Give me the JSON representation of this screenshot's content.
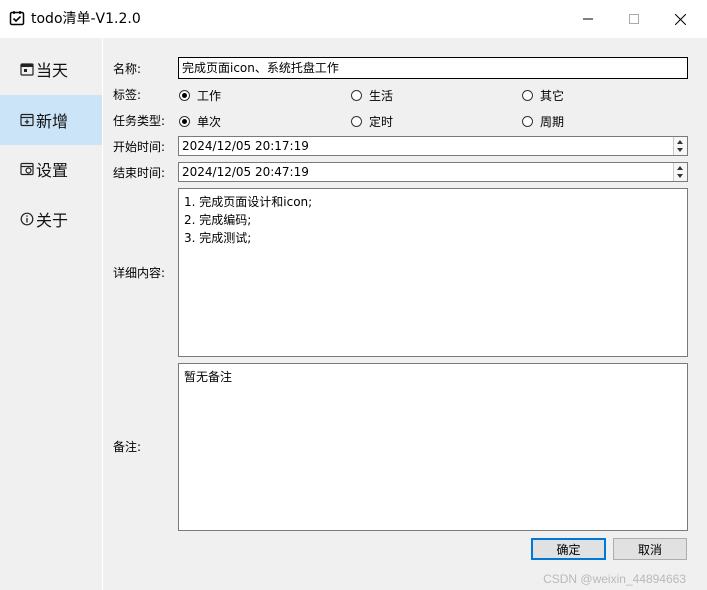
{
  "window": {
    "title": "todo清单-V1.2.0",
    "icons": {
      "app": "calendar-check-icon",
      "minimize": "minimize-icon",
      "maximize": "maximize-icon",
      "close": "close-icon"
    }
  },
  "sidebar": {
    "items": [
      {
        "label": "当天",
        "icon": "today-icon",
        "active": false
      },
      {
        "label": "新增",
        "icon": "add-icon",
        "active": true
      },
      {
        "label": "设置",
        "icon": "settings-icon",
        "active": false
      },
      {
        "label": "关于",
        "icon": "info-icon",
        "active": false
      }
    ]
  },
  "form": {
    "name_label": "名称:",
    "name_value": "完成页面icon、系统托盘工作",
    "tag_label": "标签:",
    "tags": [
      {
        "label": "工作",
        "checked": true
      },
      {
        "label": "生活",
        "checked": false
      },
      {
        "label": "其它",
        "checked": false
      }
    ],
    "task_type_label": "任务类型:",
    "task_types": [
      {
        "label": "单次",
        "checked": true
      },
      {
        "label": "定时",
        "checked": false
      },
      {
        "label": "周期",
        "checked": false
      }
    ],
    "start_label": "开始时间:",
    "start_value": "2024/12/05 20:17:19",
    "end_label": "结束时间:",
    "end_value": "2024/12/05 20:47:19",
    "detail_label": "详细内容:",
    "detail_lines": [
      "1. 完成页面设计和icon;",
      "2. 完成编码;",
      "3. 完成测试;"
    ],
    "remark_label": "备注:",
    "remark_value": "暂无备注",
    "confirm_label": "确定",
    "cancel_label": "取消"
  },
  "watermark": "CSDN @weixin_44894663",
  "colors": {
    "sidebar_active": "#cce4f7",
    "default_button_border": "#0078d7"
  }
}
